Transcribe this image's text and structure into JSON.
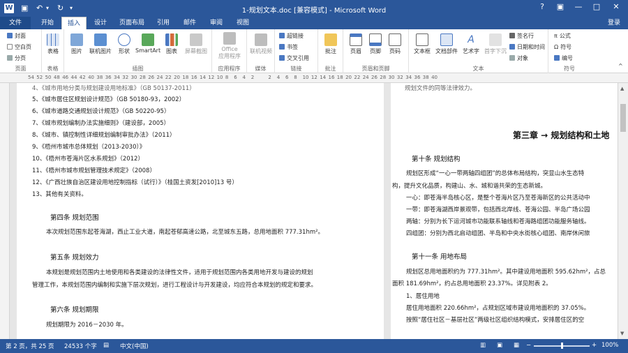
{
  "titlebar": {
    "title": "1-规划文本.doc [兼容模式] - Microsoft Word",
    "help": "?",
    "restore_ribbon": "▣",
    "minimize": "—",
    "maximize": "□",
    "close": "✕",
    "login": "登录"
  },
  "tabs": [
    "文件",
    "开始",
    "插入",
    "设计",
    "页面布局",
    "引用",
    "邮件",
    "审阅",
    "视图"
  ],
  "active_tab": "插入",
  "ribbon": {
    "pages_group": {
      "label": "页面",
      "cover": "封面",
      "blank": "空白页",
      "break": "分页"
    },
    "tables_group": {
      "label": "表格",
      "table": "表格"
    },
    "illustrations_group": {
      "label": "插图",
      "picture": "图片",
      "online_picture": "联机图片",
      "shapes": "形状",
      "smartart": "SmartArt",
      "chart": "图表",
      "screenshot": "屏幕截图"
    },
    "apps_group": {
      "label": "应用程序",
      "office_apps_line1": "Office",
      "office_apps_line2": "应用程序"
    },
    "media_group": {
      "label": "媒体",
      "online_video": "联机视频"
    },
    "links_group": {
      "label": "链接",
      "hyperlink": "超链接",
      "bookmark": "书签",
      "cross_ref": "交叉引用"
    },
    "comments_group": {
      "label": "批注",
      "comment": "批注"
    },
    "header_footer_group": {
      "label": "页眉和页脚",
      "header": "页眉",
      "footer": "页脚",
      "page_number": "页码"
    },
    "text_group": {
      "label": "文本",
      "textbox": "文本框",
      "quick_parts": "文档部件",
      "wordart": "艺术字",
      "dropcap": "首字下沉",
      "signature": "签名行",
      "datetime": "日期和时间",
      "object": "对象"
    },
    "symbols_group": {
      "label": "符号",
      "equation": "公式",
      "symbol": "符号",
      "numbering": "编号"
    }
  },
  "ruler": {
    "marks": [
      "54",
      "52",
      "50",
      "48",
      "46",
      "44",
      "42",
      "40",
      "38",
      "36",
      "34",
      "32",
      "30",
      "28",
      "26",
      "24",
      "22",
      "20",
      "18",
      "16",
      "14",
      "12",
      "10",
      "8",
      "6",
      "4",
      "2",
      "",
      "2",
      "4",
      "6",
      "8",
      "10",
      "12",
      "14",
      "16",
      "18",
      "20",
      "22",
      "24",
      "26",
      "28",
      "30",
      "32",
      "34",
      "36",
      "38",
      "40"
    ]
  },
  "left_page": {
    "cut_top": "4、《城市用地分类与规划建设用地标准》（GB 50137-2011）",
    "items": [
      "5、《城市居住区规划设计规范》（GB 50180-93，2002）",
      "6、《城市道路交通规划设计规范》（GB 50220-95）",
      "7、《城市规划编制办法实施细则》（建设部，2005）",
      "8、《城市、镇控制性详细规划编制审批办法》（2011）",
      "9、《梧州市城市总体规划（2013-2030）》",
      "10、《梧州市苍海片区水系规划》（2012）",
      "11、《梧州市城市规划管理技术规定》（2008）",
      "12、《广西壮族自治区建设用地控制指标（试行）》（桂国土资发[2010]13 号）",
      "13、其他有关资料。"
    ],
    "art4_title": "第四条  规划范围",
    "art4_body": "本次规划范围东起苍海湖，西止工业大道，南起苍郁高速公路，北至城东五路，总用地面积 777.31hm²。",
    "art5_title": "第五条  规划效力",
    "art5_body1": "本规划是规划范围内土地使用和各类建设的法律性文件，适用于规划范围内各类用地开发与建设的规划",
    "art5_body2": "管理工作，本规划范围内编制和实施下层次规划，进行工程设计与开发建设，均应符合本规划的规定和要求。",
    "art6_title": "第六条  规划期限",
    "art6_body": "规划期限为 2016－2030 年。"
  },
  "right_page": {
    "cut_top": "规划文件的同等法律效力。",
    "chapter": "第三章  →  规划结构和土地",
    "art10_title": "第十条  规划结构",
    "art10_p1": "规划区形成“一心一带两轴四组团”的总体布局结构，突显山水生态特",
    "art10_p2": "构，提升文化品质，构建山、水、城和谐共荣的生态新城。",
    "art10_p3": "一心：即苍海半岛核心区，是整个苍海片区乃至苍海新区的公共活动中",
    "art10_p4": "一带：即苍海湖西岸景观带，包括西北岸线、苍海公园、半岛广场公园",
    "art10_p5": "两轴：分别为长下运河城市功能联系轴线和苍海路组团功能服务轴线。",
    "art10_p6": "四组团：分别为西北启动组团、半岛和中央水街核心组团、南岸休闲旅",
    "art11_title": "第十一条  用地布局",
    "art11_p1": "规划区总用地面积约为 777.31hm²。其中建设用地面积 595.62hm²，占总",
    "art11_p2": "面积 181.69hm²，约占总用地面积 23.37%。详见附表 2。",
    "art11_p3": "1、居住用地",
    "art11_p4": "居住用地面积 220.66hm²，占规划区域市建设用地面积的 37.05%。",
    "art11_p5": "按照“居住社区－基层社区”两级社区组织结构模式，安排居住区的空"
  },
  "statusbar": {
    "page": "第 2 页，共 25 页",
    "words": "24533 个字",
    "language": "中文(中国)",
    "zoom": "100%",
    "zoom_minus": "−",
    "zoom_plus": "+"
  }
}
